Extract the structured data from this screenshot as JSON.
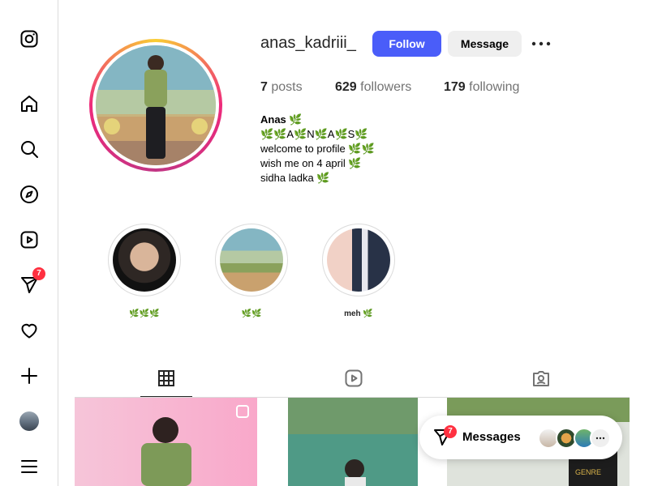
{
  "sidebar": {
    "badge_count": "7"
  },
  "profile": {
    "username": "anas_kadriii_",
    "follow_label": "Follow",
    "message_label": "Message",
    "stats": {
      "posts_count": "7",
      "posts_label": "posts",
      "followers_count": "629",
      "followers_label": "followers",
      "following_count": "179",
      "following_label": "following"
    },
    "bio": {
      "name": "Anas 🌿",
      "line1": "🌿🌿A🌿N🌿A🌿S🌿",
      "line2": "welcome to profile 🌿🌿",
      "line3": "wish me on 4 april 🌿",
      "line4": "sidha ladka 🌿"
    }
  },
  "highlights": [
    {
      "label": "🌿🌿🌿"
    },
    {
      "label": "🌿🌿"
    },
    {
      "label": "meh 🌿"
    }
  ],
  "messages": {
    "label": "Messages",
    "badge": "7"
  },
  "colors": {
    "accent": "#4a5df9",
    "badge": "#ff3040"
  }
}
